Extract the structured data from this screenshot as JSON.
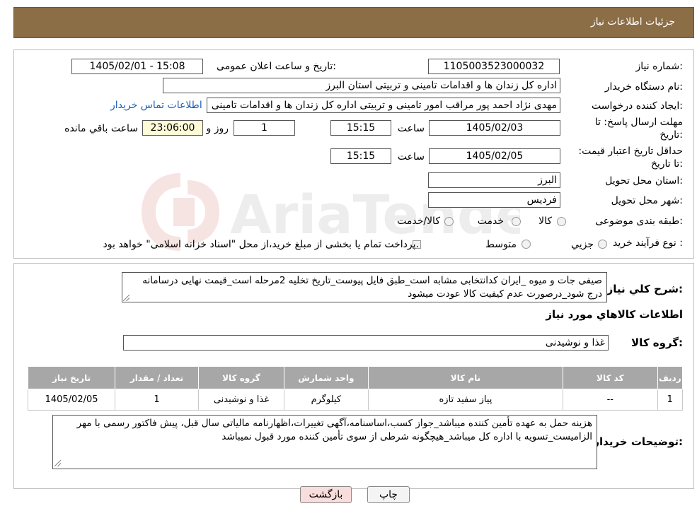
{
  "header": {
    "title": "جزئیات اطلاعات نیاز"
  },
  "form": {
    "need_number_label": "شماره نیاز:",
    "need_number": "1105003523000032",
    "announce_label": "تاریخ و ساعت اعلان عمومی:",
    "announce_value": "1405/02/01 - 15:08",
    "buyer_org_label": "نام دستگاه خریدار:",
    "buyer_org": "اداره کل زندان ها و اقدامات تامینی و تربیتی استان البرز",
    "requester_label": "ایجاد کننده درخواست:",
    "requester": "مهدی نژاد احمد پور مراقب امور تامینی و تربیتی اداره کل زندان ها و اقدامات تامینی",
    "contact_link": "اطلاعات تماس خریدار",
    "deadline_label": "مهلت ارسال پاسخ: تا تاریخ:",
    "deadline_date": "1405/02/03",
    "time_label": "ساعت",
    "deadline_time": "15:15",
    "days_value": "1",
    "days_label": "روز و",
    "remaining_value": "23:06:00",
    "remaining_label": "ساعت باقي مانده",
    "validity_label": "حداقل تاریخ اعتبار قیمت: تا تاریخ:",
    "validity_date": "1405/02/05",
    "validity_time": "15:15",
    "province_label": "استان محل تحویل:",
    "province": "البرز",
    "city_label": "شهر محل تحویل:",
    "city": "فردیس",
    "category_label": "طبقه بندی موضوعی:",
    "category_options": [
      "کالا",
      "خدمت",
      "کالا/خدمت"
    ],
    "process_label": "نوع فرآیند خرید :",
    "process_options": [
      "جزيي",
      "متوسط"
    ],
    "process_note": "پرداخت تمام یا بخشی از مبلغ خرید،از محل \"اسناد خزانه اسلامی\" خواهد بود."
  },
  "summary": {
    "label": "شرح کلي نیاز:",
    "text": "صیفی جات و میوه _ایران کدانتخابی مشابه است_طبق فایل پیوست_تاریخ تخلیه 2مرحله است_قیمت نهایی درسامانه درج شود_درصورت عدم کیفیت کالا عودت میشود",
    "goods_info_title": "اطلاعات کالاهاي مورد نیاز",
    "goods_group_label": "گروه کالا:",
    "goods_group": "غذا و نوشیدنی"
  },
  "table": {
    "headers": [
      "ردیف",
      "کد کالا",
      "نام کالا",
      "واحد شمارش",
      "گروه کالا",
      "تعداد / مقدار",
      "تاریخ نیاز"
    ],
    "rows": [
      [
        "1",
        "--",
        "پیاز سفید تازه",
        "کیلوگرم",
        "غذا و نوشیدنی",
        "1",
        "1405/02/05"
      ]
    ]
  },
  "buyer_notes": {
    "label": "توضیحات خریدار:",
    "text": "هزینه حمل به عهده تأمین کننده میباشد_جواز کسب،اساسنامه،آگهی تغییرات،اظهارنامه مالیاتی سال قبل، پیش فاکتور رسمی با مهر الزامیست_تسویه با اداره کل میباشد_هیچگونه شرطی از سوی تأمین کننده مورد قبول نمیباشد"
  },
  "buttons": {
    "print": "چاپ",
    "back": "بازگشت"
  },
  "watermark": {
    "text": "AriaTender.neT"
  },
  "colors": {
    "header_bg": "#8b6d46",
    "link": "#1a5fb4",
    "table_header": "#a7a7a7",
    "back_button_bg": "#f9dcdc"
  }
}
